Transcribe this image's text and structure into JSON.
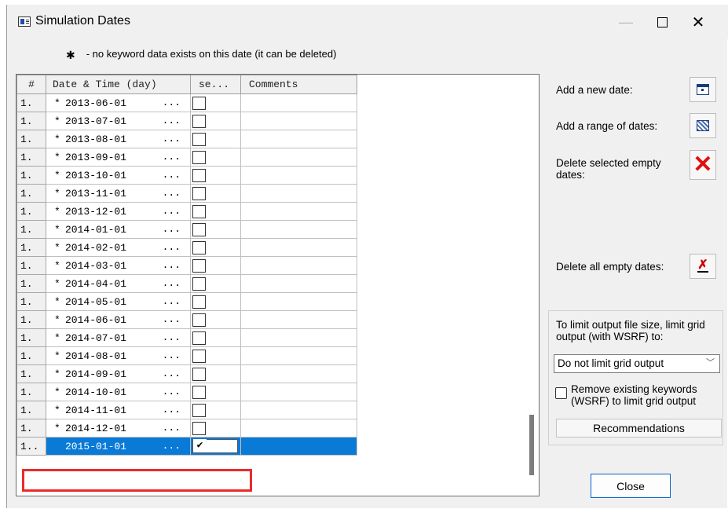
{
  "window": {
    "title": "Simulation Dates",
    "minimize_glyph": "—",
    "close_glyph": "✕"
  },
  "legend": {
    "symbol": "✱",
    "text": "- no keyword data exists on this date (it can be deleted)"
  },
  "table": {
    "headers": [
      "#",
      "Date & Time (day)",
      "se...",
      "Comments"
    ],
    "rows": [
      {
        "num": "1.",
        "marker": "*",
        "date": "2013-06-01",
        "ellipsis": "...",
        "checked": false,
        "comment": ""
      },
      {
        "num": "1.",
        "marker": "*",
        "date": "2013-07-01",
        "ellipsis": "...",
        "checked": false,
        "comment": ""
      },
      {
        "num": "1.",
        "marker": "*",
        "date": "2013-08-01",
        "ellipsis": "...",
        "checked": false,
        "comment": ""
      },
      {
        "num": "1.",
        "marker": "*",
        "date": "2013-09-01",
        "ellipsis": "...",
        "checked": false,
        "comment": ""
      },
      {
        "num": "1.",
        "marker": "*",
        "date": "2013-10-01",
        "ellipsis": "...",
        "checked": false,
        "comment": ""
      },
      {
        "num": "1.",
        "marker": "*",
        "date": "2013-11-01",
        "ellipsis": "...",
        "checked": false,
        "comment": ""
      },
      {
        "num": "1.",
        "marker": "*",
        "date": "2013-12-01",
        "ellipsis": "...",
        "checked": false,
        "comment": ""
      },
      {
        "num": "1.",
        "marker": "*",
        "date": "2014-01-01",
        "ellipsis": "...",
        "checked": false,
        "comment": ""
      },
      {
        "num": "1.",
        "marker": "*",
        "date": "2014-02-01",
        "ellipsis": "...",
        "checked": false,
        "comment": ""
      },
      {
        "num": "1.",
        "marker": "*",
        "date": "2014-03-01",
        "ellipsis": "...",
        "checked": false,
        "comment": ""
      },
      {
        "num": "1.",
        "marker": "*",
        "date": "2014-04-01",
        "ellipsis": "...",
        "checked": false,
        "comment": ""
      },
      {
        "num": "1.",
        "marker": "*",
        "date": "2014-05-01",
        "ellipsis": "...",
        "checked": false,
        "comment": ""
      },
      {
        "num": "1.",
        "marker": "*",
        "date": "2014-06-01",
        "ellipsis": "...",
        "checked": false,
        "comment": ""
      },
      {
        "num": "1.",
        "marker": "*",
        "date": "2014-07-01",
        "ellipsis": "...",
        "checked": false,
        "comment": ""
      },
      {
        "num": "1.",
        "marker": "*",
        "date": "2014-08-01",
        "ellipsis": "...",
        "checked": false,
        "comment": ""
      },
      {
        "num": "1.",
        "marker": "*",
        "date": "2014-09-01",
        "ellipsis": "...",
        "checked": false,
        "comment": ""
      },
      {
        "num": "1.",
        "marker": "*",
        "date": "2014-10-01",
        "ellipsis": "...",
        "checked": false,
        "comment": ""
      },
      {
        "num": "1.",
        "marker": "*",
        "date": "2014-11-01",
        "ellipsis": "...",
        "checked": false,
        "comment": ""
      },
      {
        "num": "1.",
        "marker": "*",
        "date": "2014-12-01",
        "ellipsis": "...",
        "checked": false,
        "comment": ""
      },
      {
        "num": "1..",
        "marker": "",
        "date": "2015-01-01",
        "ellipsis": "...",
        "checked": true,
        "comment": "",
        "selected": true
      }
    ],
    "check_glyph": "✔"
  },
  "actions": {
    "add_date_label": "Add a new date:",
    "add_range_label": "Add a range of dates:",
    "delete_selected_label": "Delete selected empty dates:",
    "delete_all_label": "Delete all empty dates:",
    "delete_selected_glyph": "✕",
    "delete_all_glyph": "✗"
  },
  "output": {
    "description": "To limit output file size, limit grid output (with WSRF) to:",
    "selected_option": "Do not limit grid output",
    "remove_keywords_label": "Remove existing keywords (WSRF) to limit grid output",
    "remove_keywords_checked": false,
    "recommendations_label": "Recommendations",
    "dropdown_glyph": "﹀"
  },
  "footer": {
    "close_label": "Close"
  }
}
